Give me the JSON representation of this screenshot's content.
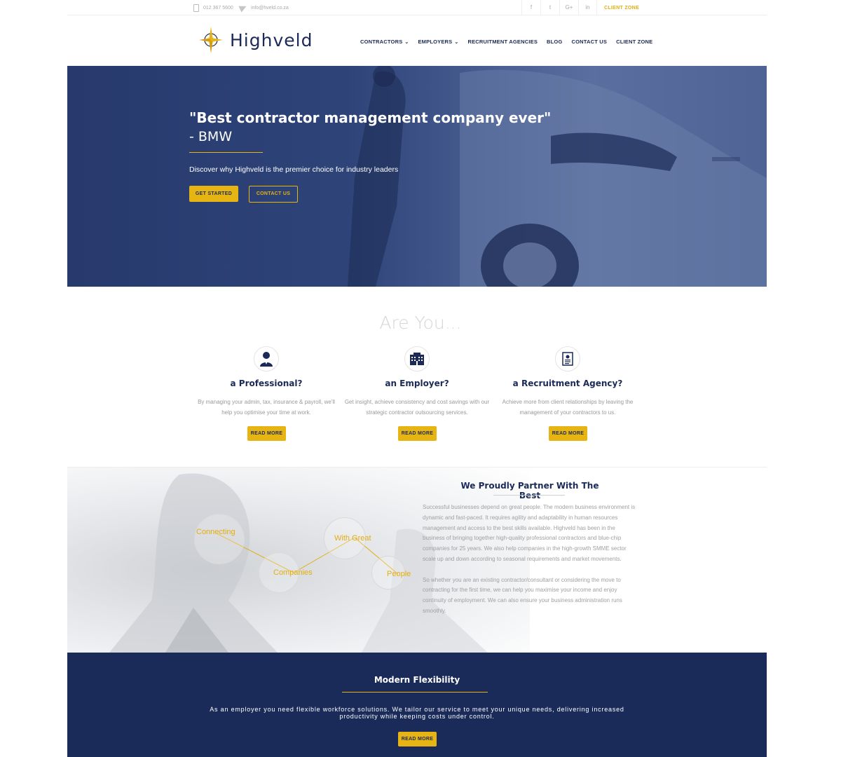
{
  "topbar": {
    "phone": "012 367 5600",
    "email": "info@hveld.co.za",
    "social": [
      "f",
      "t",
      "G+",
      "in"
    ],
    "client_zone": "CLIENT ZONE"
  },
  "brand": {
    "name": "Highveld",
    "primary_color": "#1b2a57",
    "accent_color": "#e6b413"
  },
  "nav": {
    "items": [
      {
        "label": "CONTRACTORS",
        "dropdown": true
      },
      {
        "label": "EMPLOYERS",
        "dropdown": true
      },
      {
        "label": "RECRUITMENT AGENCIES",
        "dropdown": false
      },
      {
        "label": "BLOG",
        "dropdown": false
      },
      {
        "label": "CONTACT US",
        "dropdown": false
      },
      {
        "label": "CLIENT ZONE",
        "dropdown": false
      }
    ]
  },
  "hero": {
    "quote": "\"Best contractor management company ever\"",
    "author": "- BMW",
    "subtitle": "Discover why Highveld is the premier choice for industry leaders",
    "primary_button": "GET STARTED",
    "secondary_button": "CONTACT US"
  },
  "are_you": {
    "heading": "Are You...",
    "cards": [
      {
        "icon": "professional-person-icon",
        "title": "a Professional?",
        "text": "By managing your admin, tax, insurance & payroll, we'll help you optimise your time at work.",
        "button": "READ MORE"
      },
      {
        "icon": "office-building-icon",
        "title": "an Employer?",
        "text": "Get insight, achieve consistency and cost savings with our strategic contractor outsourcing services.",
        "button": "READ MORE"
      },
      {
        "icon": "id-document-icon",
        "title": "a Recruitment Agency?",
        "text": "Achieve more from client relationships by leaving the management of your contractors to us.",
        "button": "READ MORE"
      }
    ]
  },
  "partner": {
    "title": "We Proudly Partner With The Best",
    "paragraph1": "Successful businesses depend on great people. The modern business environment is dynamic and fast-paced. It requires agility and adaptability in human resources management and access to the best skills available. Highveld has been in the business of bringing together high-quality professional contractors and blue-chip companies for 25 years. We also help companies in the high-growth SMME sector scale up and down according to seasonal requirements and market movements.",
    "paragraph2": "So whether you are an existing contractor/consultant or considering the move to contracting for the first time, we can help you maximise your income and enjoy continuity of employment. We can also ensure your business administration runs smoothly.",
    "bubbles": [
      "Connecting",
      "Companies",
      "With Great",
      "People"
    ]
  },
  "flex": {
    "title": "Modern Flexibility",
    "text": "As an employer you need flexible workforce solutions. We tailor our service to meet your unique needs, delivering increased productivity while keeping costs under control.",
    "button": "READ MORE"
  }
}
